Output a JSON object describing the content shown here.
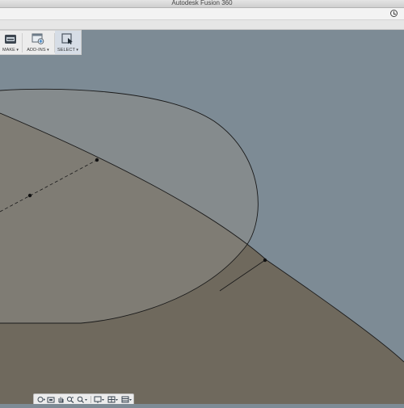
{
  "window": {
    "title": "Autodesk Fusion 360"
  },
  "header": {
    "icons": [
      "clock-icon"
    ]
  },
  "toolbar": {
    "make_label": "MAKE",
    "addins_label": "ADD-INS",
    "select_label": "SELECT",
    "icons": [
      "make-icon",
      "addins-icon",
      "select-icon"
    ]
  },
  "viewport": {
    "colors": {
      "background": "#7d8b95",
      "body": "#6f695d",
      "sketch_profile": "#8c8c86",
      "line": "#1a1a1a"
    }
  },
  "navbar": {
    "icons": [
      "orbit-icon",
      "look-at-icon",
      "pan-icon",
      "zoom-icon",
      "zoom-window-icon",
      "display-settings-icon",
      "grid-settings-icon",
      "viewports-icon"
    ]
  }
}
